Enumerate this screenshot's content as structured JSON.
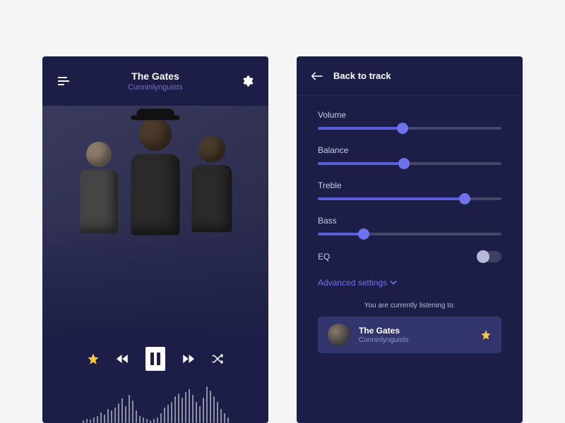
{
  "player": {
    "track_title": "The Gates",
    "track_artist": "Cunninlynguists"
  },
  "settings": {
    "back_label": "Back to track",
    "sliders": [
      {
        "label": "Volume",
        "value": 46
      },
      {
        "label": "Balance",
        "value": 47
      },
      {
        "label": "Treble",
        "value": 80
      },
      {
        "label": "Bass",
        "value": 25
      }
    ],
    "eq_label": "EQ",
    "eq_on": false,
    "advanced_label": "Advanced settings",
    "now_playing_label": "You are currently listening to:",
    "now_playing": {
      "title": "The Gates",
      "artist": "Cunninlynguists",
      "favorited": true
    }
  },
  "icons": {
    "menu": "menu-icon",
    "gear": "gear-icon",
    "back": "back-arrow-icon",
    "star": "star-icon",
    "rewind": "rewind-icon",
    "pause": "pause-icon",
    "forward": "forward-icon",
    "shuffle": "shuffle-icon",
    "chevron_down": "chevron-down-icon"
  },
  "waveform_heights": [
    4,
    6,
    5,
    8,
    10,
    15,
    12,
    20,
    18,
    22,
    28,
    35,
    24,
    40,
    32,
    18,
    10,
    8,
    6,
    4,
    6,
    8,
    14,
    22,
    26,
    30,
    38,
    42,
    36,
    44,
    48,
    40,
    30,
    24,
    36,
    52,
    46,
    38,
    30,
    20,
    14,
    8
  ]
}
